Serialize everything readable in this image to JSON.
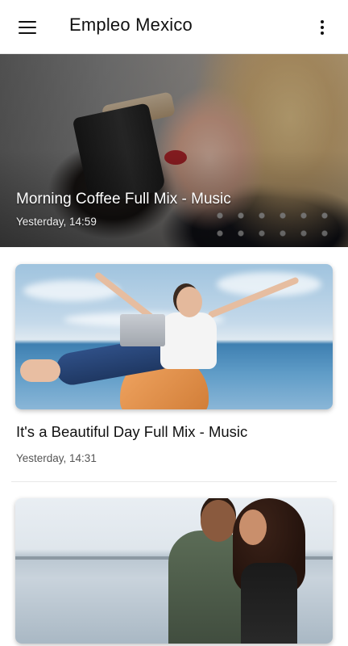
{
  "app_bar": {
    "title": "Empleo Mexico",
    "menu_icon": "hamburger-menu-icon",
    "overflow_icon": "more-vertical-icon"
  },
  "featured": {
    "title": "Morning Coffee Full Mix - Music",
    "time": "Yesterday, 14:59"
  },
  "items": [
    {
      "title": "It's a Beautiful Day Full Mix - Music",
      "time": "Yesterday, 14:31"
    },
    {
      "title": "",
      "time": ""
    }
  ],
  "colors": {
    "app_bar_bg": "#ffffff",
    "text_primary": "#111111",
    "text_secondary": "#555555",
    "divider": "#e8e8e8"
  }
}
